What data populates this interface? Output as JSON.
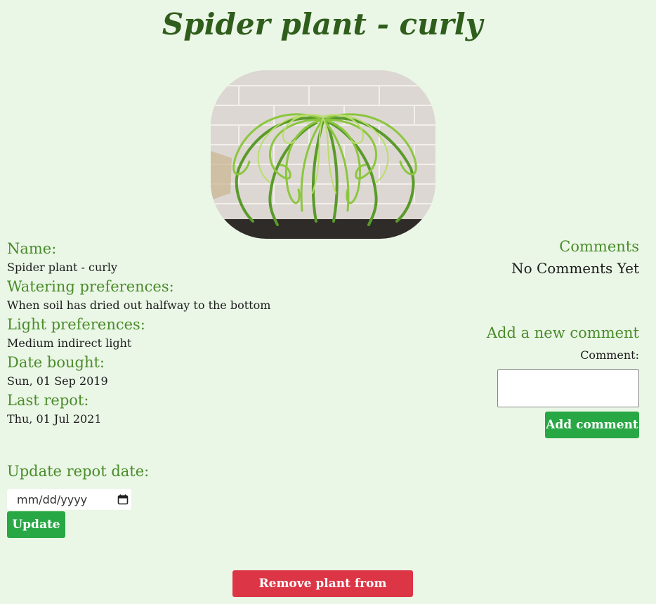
{
  "page": {
    "title": "Spider plant - curly"
  },
  "details": {
    "name_label": "Name:",
    "name_value": "Spider plant - curly",
    "watering_label": "Watering preferences:",
    "watering_value": "When soil has dried out halfway to the bottom",
    "light_label": "Light preferences:",
    "light_value": "Medium indirect light",
    "bought_label": "Date bought:",
    "bought_value": "Sun, 01 Sep 2019",
    "repot_label": "Last repot:",
    "repot_value": "Thu, 01 Jul 2021"
  },
  "update_repot": {
    "title": "Update repot date:",
    "date_placeholder": "mm/dd/yyyy",
    "update_label": "Update"
  },
  "comments": {
    "title": "Comments",
    "empty_text": "No Comments Yet",
    "add_title": "Add a new comment",
    "comment_label": "Comment:",
    "add_button_label": "Add comment"
  },
  "actions": {
    "remove_label": "Remove plant from database"
  },
  "colors": {
    "background": "#eaf6e6",
    "heading_green": "#2f5e1c",
    "label_green": "#4a8c2a",
    "success": "#28a745",
    "danger": "#dc3545"
  },
  "icons": {
    "date_picker": "calendar-icon"
  }
}
